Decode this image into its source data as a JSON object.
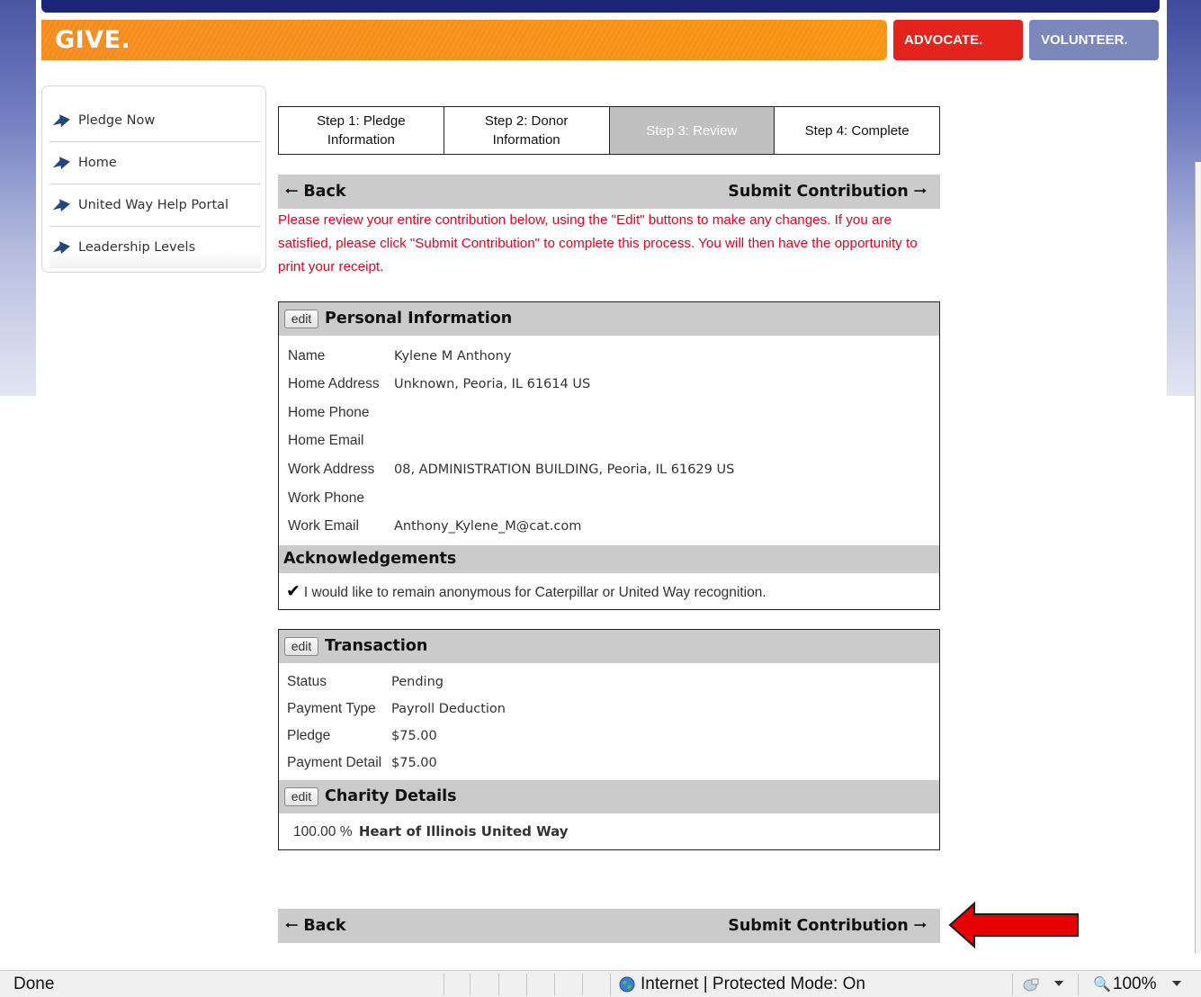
{
  "colors": {
    "give_orange": "#f68c1e",
    "advocate_red": "#e3231c",
    "volunteer_blue": "#7c87bc",
    "top_navy": "#1c2478",
    "notice_red": "#e8001c",
    "header_gray": "#cbcbcb",
    "arrow_red": "#e60000"
  },
  "header": {
    "give_label": "GIVE.",
    "advocate_label": "ADVOCATE.",
    "volunteer_label": "VOLUNTEER."
  },
  "sidebar": {
    "items": [
      {
        "label": "Pledge Now",
        "icon": "arrow-right-icon"
      },
      {
        "label": "Home",
        "icon": "arrow-right-icon"
      },
      {
        "label": "United Way Help Portal",
        "icon": "arrow-right-icon"
      },
      {
        "label": "Leadership Levels",
        "icon": "arrow-right-icon"
      }
    ]
  },
  "steps": [
    {
      "line1": "Step 1: Pledge",
      "line2": "Information",
      "active": false
    },
    {
      "line1": "Step 2: Donor",
      "line2": "Information",
      "active": false
    },
    {
      "line1": "Step 3: Review",
      "line2": "",
      "active": true
    },
    {
      "line1": "Step 4: Complete",
      "line2": "",
      "active": false
    }
  ],
  "nav": {
    "back_label": "Back",
    "submit_label": "Submit Contribution"
  },
  "notice": "Please review your entire contribution below, using the \"Edit\" buttons to make any changes. If you are satisfied, please click \"Submit Contribution\" to complete this process. You will then have the opportunity to print your receipt.",
  "personal": {
    "edit_label": "edit",
    "title": "Personal Information",
    "rows": [
      {
        "label": "Name",
        "value": "Kylene M Anthony"
      },
      {
        "label": "Home Address",
        "value": "Unknown, Peoria, IL 61614 US"
      },
      {
        "label": "Home Phone",
        "value": ""
      },
      {
        "label": "Home Email",
        "value": ""
      },
      {
        "label": "Work Address",
        "value": "08, ADMINISTRATION BUILDING, Peoria, IL 61629 US"
      },
      {
        "label": "Work Phone",
        "value": ""
      },
      {
        "label": "Work Email",
        "value": "Anthony_Kylene_M@cat.com"
      }
    ]
  },
  "acknowledgements": {
    "title": "Acknowledgements",
    "item": "I would like to remain anonymous for Caterpillar or United Way recognition.",
    "checked": true
  },
  "transaction": {
    "edit_label": "edit",
    "title": "Transaction",
    "rows": [
      {
        "label": "Status",
        "value": "Pending"
      },
      {
        "label": "Payment Type",
        "value": "Payroll Deduction"
      },
      {
        "label": "Pledge",
        "value": "$75.00"
      },
      {
        "label": "Payment Detail",
        "value": "$75.00"
      }
    ]
  },
  "charity": {
    "edit_label": "edit",
    "title": "Charity Details",
    "percent": "100.00 %",
    "name": "Heart of Illinois United Way"
  },
  "statusbar": {
    "left_text": "Done",
    "zone_text": "Internet | Protected Mode: On",
    "zoom_text": "100%"
  }
}
